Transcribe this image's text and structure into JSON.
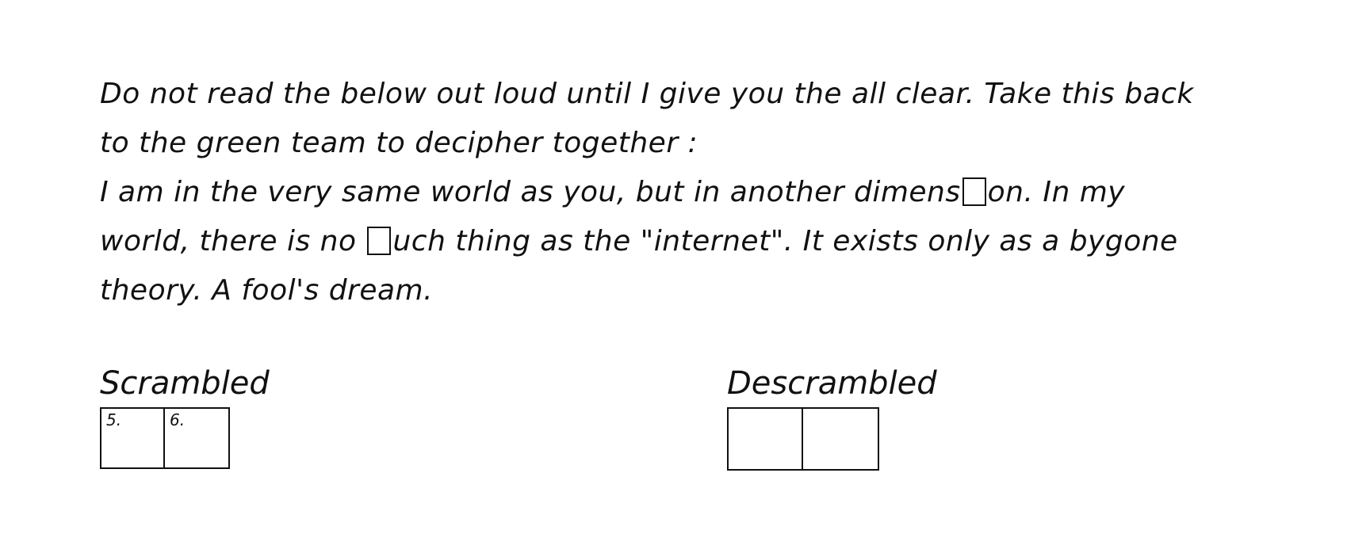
{
  "note": {
    "line1": "Do not read the below out loud until I give you the all clear. Take this back",
    "line2": "to the green team to decipher together :",
    "line3_before_blank": "I am in the very same world as you, but in another dimens",
    "line3_after_blank": "on. In my",
    "line4_before_blank": "world, there is no ",
    "line4_after_blank": "uch thing as the \"internet\". It exists only as a bygone",
    "line5": "theory. A fool's dream."
  },
  "scrambled": {
    "title": "Scrambled",
    "cells": [
      "5.",
      "6."
    ]
  },
  "descrambled": {
    "title": "Descrambled",
    "cells": [
      "",
      ""
    ]
  }
}
